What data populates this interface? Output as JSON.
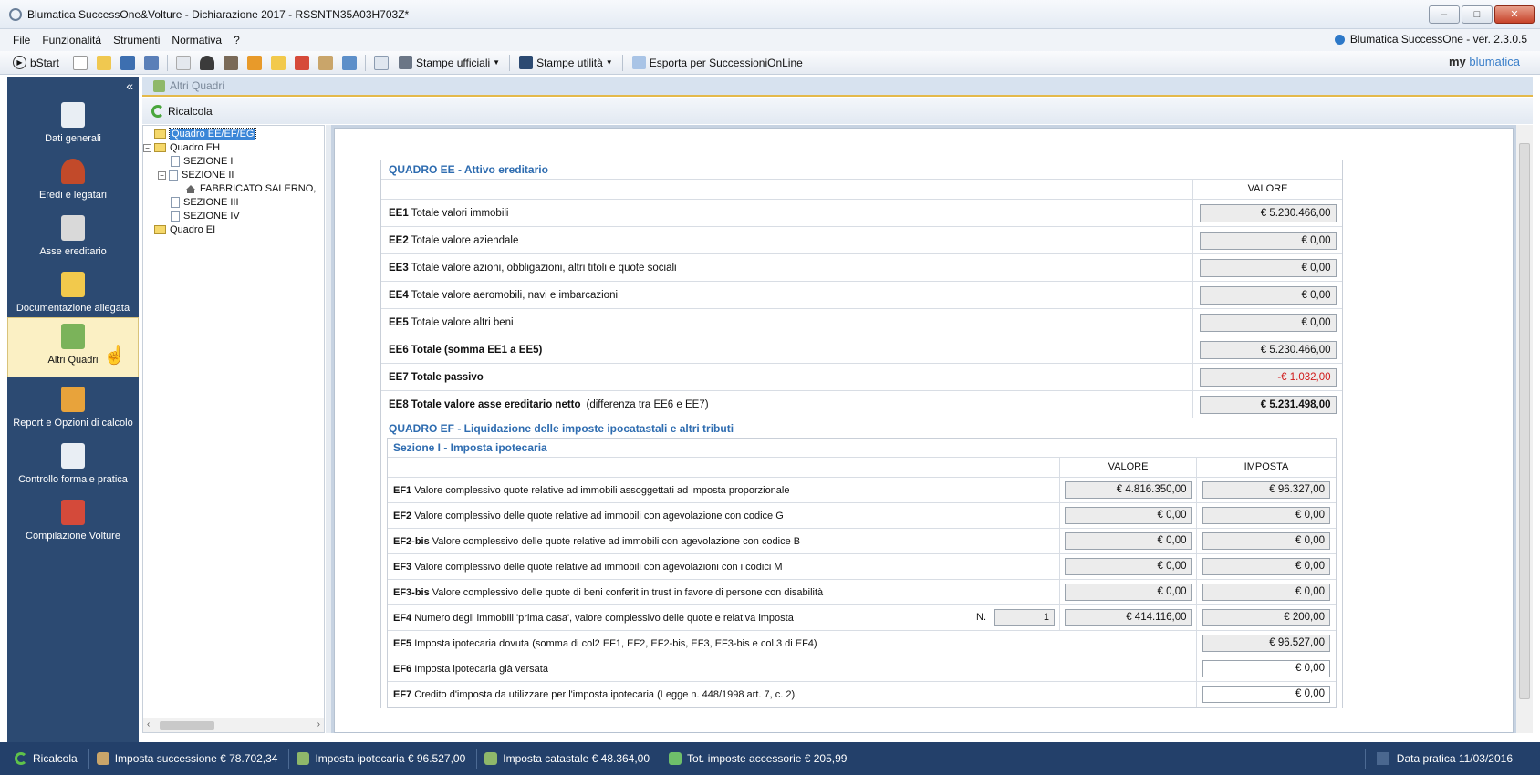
{
  "window": {
    "title": "Blumatica SuccessOne&Volture - Dichiarazione 2017 - RSSNTN35A03H703Z*",
    "minimize": "–",
    "maximize": "□",
    "close": "✕"
  },
  "menu": {
    "items": [
      "File",
      "Funzionalità",
      "Strumenti",
      "Normativa",
      "?"
    ],
    "version": "Blumatica SuccessOne - ver. 2.3.0.5"
  },
  "toolbar": {
    "start_label": "bStart",
    "stampe_ufficiali": "Stampe ufficiali",
    "stampe_utilita": "Stampe utilità",
    "esporta": "Esporta per SuccessioniOnLine",
    "logo_my": "my",
    "logo_brand": "blumatica"
  },
  "sidebar": {
    "collapse_icon": "«",
    "items": [
      {
        "label": "Dati generali",
        "icon": "document-icon",
        "color": "#e9eef4"
      },
      {
        "label": "Eredi e legatari",
        "icon": "person-icon",
        "color": "#c24a2a"
      },
      {
        "label": "Asse ereditario",
        "icon": "house-icon",
        "color": "#d9d9d9"
      },
      {
        "label": "Documentazione allegata",
        "icon": "folder-word-icon",
        "color": "#f2c94c"
      },
      {
        "label": "Altri Quadri",
        "icon": "edit-form-icon",
        "color": "#7bb35a"
      },
      {
        "label": "Report e Opzioni di calcolo",
        "icon": "calculator-icon",
        "color": "#e8a33b"
      },
      {
        "label": "Controllo formale pratica",
        "icon": "checklist-icon",
        "color": "#e9eef4"
      },
      {
        "label": "Compilazione Volture",
        "icon": "map-icon",
        "color": "#d44a3a"
      }
    ],
    "active_index": 4
  },
  "main": {
    "section_title": "Altri Quadri",
    "recalc_label": "Ricalcola"
  },
  "tree": {
    "nodes": [
      {
        "label": "Quadro EE/EF/EG",
        "type": "folder",
        "selected": true
      },
      {
        "label": "Quadro EH",
        "type": "folder"
      },
      {
        "label": "SEZIONE I",
        "type": "page"
      },
      {
        "label": "SEZIONE II",
        "type": "page"
      },
      {
        "label": "FABBRICATO SALERNO,",
        "type": "house"
      },
      {
        "label": "SEZIONE III",
        "type": "page"
      },
      {
        "label": "SEZIONE IV",
        "type": "page"
      },
      {
        "label": "Quadro EI",
        "type": "folder"
      }
    ],
    "expander_minus": "−",
    "scroll_left": "‹",
    "scroll_right": "›"
  },
  "quadro_ee": {
    "title": "QUADRO EE - Attivo ereditario",
    "col_header": "VALORE",
    "rows": [
      {
        "code": "EE1",
        "label": "Totale valori immobili",
        "value": "€ 5.230.466,00"
      },
      {
        "code": "EE2",
        "label": "Totale valore aziendale",
        "value": "€ 0,00"
      },
      {
        "code": "EE3",
        "label": "Totale valore azioni, obbligazioni, altri titoli e quote sociali",
        "value": "€ 0,00"
      },
      {
        "code": "EE4",
        "label": "Totale valore aeromobili, navi e imbarcazioni",
        "value": "€ 0,00"
      },
      {
        "code": "EE5",
        "label": "Totale valore altri beni",
        "value": "€ 0,00"
      },
      {
        "code": "EE6",
        "label": "Totale (somma EE1 a EE5)",
        "value": "€ 5.230.466,00"
      },
      {
        "code": "EE7",
        "label": "Totale passivo",
        "value": "-€ 1.032,00"
      },
      {
        "code": "EE8",
        "label": "Totale valore asse ereditario netto",
        "note": "(differenza tra EE6 e EE7)",
        "value": "€ 5.231.498,00"
      }
    ]
  },
  "quadro_ef": {
    "title": "QUADRO EF - Liquidazione delle imposte ipocatastali e altri tributi",
    "sezione_title": "Sezione I - Imposta ipotecaria",
    "col_valore": "VALORE",
    "col_imposta": "IMPOSTA",
    "rows": [
      {
        "code": "EF1",
        "label": "Valore complessivo quote relative ad immobili assoggettati ad imposta proporzionale",
        "valore": "€ 4.816.350,00",
        "imposta": "€ 96.327,00"
      },
      {
        "code": "EF2",
        "label": "Valore complessivo delle quote relative ad immobili con agevolazione con codice G",
        "valore": "€ 0,00",
        "imposta": "€ 0,00"
      },
      {
        "code": "EF2-bis",
        "label": "Valore complessivo delle quote relative ad immobili con agevolazione con codice B",
        "valore": "€ 0,00",
        "imposta": "€ 0,00"
      },
      {
        "code": "EF3",
        "label": "Valore complessivo delle quote relative ad immobili con agevolazioni con i codici M",
        "valore": "€ 0,00",
        "imposta": "€ 0,00"
      },
      {
        "code": "EF3-bis",
        "label": "Valore complessivo delle quote di beni conferit in trust in favore di persone con disabilità",
        "valore": "€ 0,00",
        "imposta": "€ 0,00"
      },
      {
        "code": "EF4",
        "label": "Numero degli immobili 'prima casa', valore complessivo delle quote e relativa imposta",
        "n_label": "N.",
        "n_value": "1",
        "valore": "€ 414.116,00",
        "imposta": "€ 200,00"
      },
      {
        "code": "EF5",
        "label": "Imposta ipotecaria dovuta (somma di col2 EF1, EF2, EF2-bis, EF3, EF3-bis e col 3 di EF4)",
        "imposta": "€ 96.527,00"
      },
      {
        "code": "EF6",
        "label": "Imposta ipotecaria già versata",
        "imposta": "€ 0,00"
      },
      {
        "code": "EF7",
        "label": "Credito d'imposta da utilizzare per l'imposta ipotecaria (Legge n. 448/1998 art. 7, c. 2)",
        "imposta": "€ 0,00"
      }
    ]
  },
  "statusbar": {
    "ricalcola": "Ricalcola",
    "successione": "Imposta successione € 78.702,34",
    "ipotecaria": "Imposta ipotecaria € 96.527,00",
    "catastale": "Imposta catastale € 48.364,00",
    "accessorie": "Tot. imposte accessorie € 205,99",
    "data_pratica": "Data pratica 11/03/2016"
  }
}
